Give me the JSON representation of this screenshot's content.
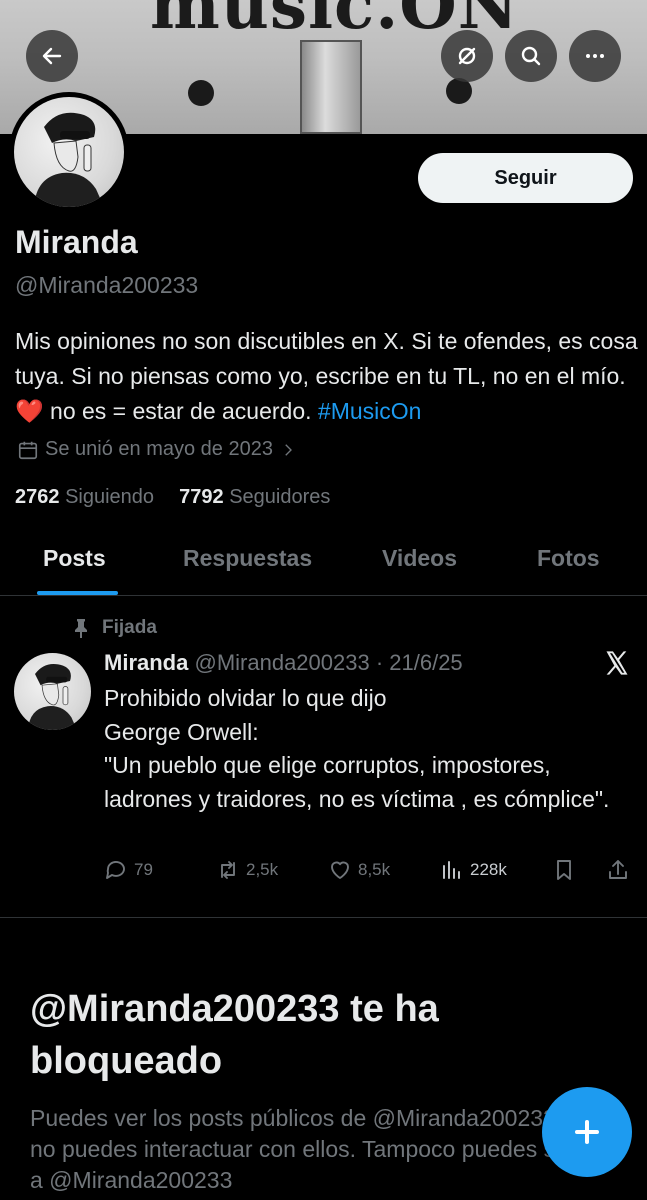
{
  "banner": {
    "text": "music.ON"
  },
  "header": {
    "back_icon": "arrow-left-icon",
    "buttons": [
      "eye-off-icon",
      "search-icon",
      "more-icon"
    ]
  },
  "profile": {
    "name": "Miranda",
    "handle": "@Miranda200233",
    "follow_label": "Seguir",
    "bio_text": "Mis opiniones no son discutibles en X. Si te ofendes, es cosa tuya. Si no piensas como yo, escribe en tu TL, no en el mío. ❤️ no es = estar de acuerdo. ",
    "bio_hashtag": "#MusicOn",
    "joined": "Se unió en mayo de 2023",
    "following_count": "2762",
    "following_label": "Siguiendo",
    "followers_count": "7792",
    "followers_label": "Seguidores"
  },
  "tabs": [
    {
      "label": "Posts",
      "active": true
    },
    {
      "label": "Respuestas",
      "active": false
    },
    {
      "label": "Videos",
      "active": false
    },
    {
      "label": "Fotos",
      "active": false
    }
  ],
  "pinned_post": {
    "pinned_label": "Fijada",
    "author": "Miranda",
    "meta": "@Miranda200233 · 21/6/25",
    "text": "Prohibido olvidar lo que dijo\nGeorge Orwell:\n\"Un pueblo que elige corruptos, impostores, ladrones y traidores, no es víctima , es cómplice\".",
    "replies": "79",
    "reposts": "2,5k",
    "likes": "8,5k",
    "views": "228k"
  },
  "blocked": {
    "title": "@Miranda200233 te ha bloqueado",
    "text": "Puedes ver los posts públicos de @Miranda200233, pero no puedes interactuar con ellos. Tampoco puedes seguir a @Miranda200233"
  },
  "colors": {
    "accent": "#1d9bf0",
    "background": "#000000",
    "muted": "#71767b"
  }
}
